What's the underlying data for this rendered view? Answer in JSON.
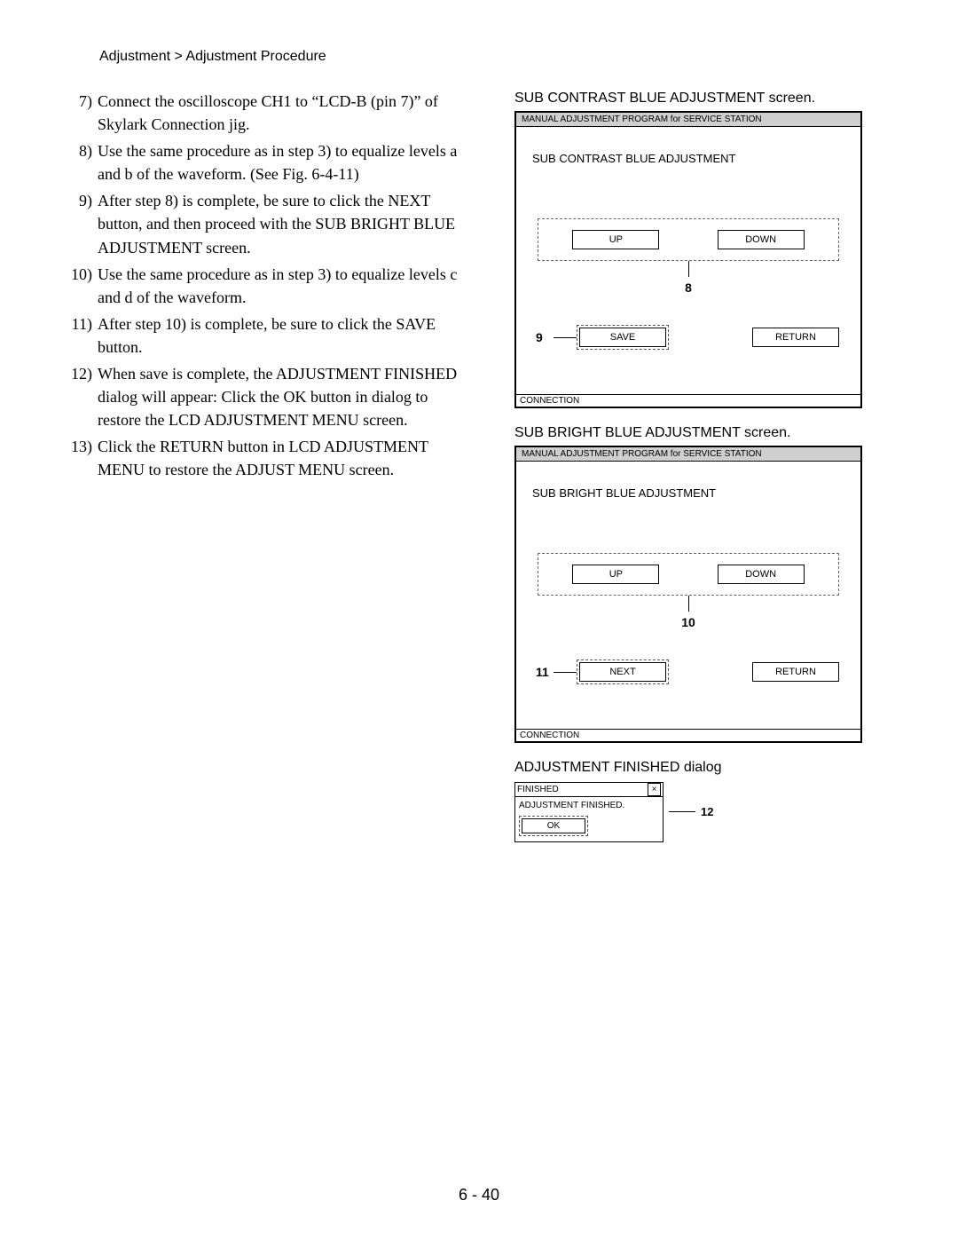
{
  "breadcrumb": "Adjustment > Adjustment Procedure",
  "steps": [
    {
      "num": "7)",
      "text": "Connect the oscilloscope CH1 to “LCD-B (pin 7)” of Skylark Connection jig."
    },
    {
      "num": "8)",
      "text": "Use the same procedure as in step 3) to equalize levels a and b of the waveform. (See Fig. 6-4-11)"
    },
    {
      "num": "9)",
      "text": "After step 8) is complete, be sure to click the NEXT button, and then proceed with the SUB BRIGHT BLUE ADJUSTMENT screen."
    },
    {
      "num": "10)",
      "text": "Use the same procedure as in step 3) to equalize levels c and d of the waveform."
    },
    {
      "num": "11)",
      "text": "After step 10) is complete, be sure to click the SAVE button."
    },
    {
      "num": "12)",
      "text": "When save is complete, the ADJUSTMENT FINISHED dialog will appear: Click the OK button in dialog to restore the LCD ADJUSTMENT MENU screen."
    },
    {
      "num": "13)",
      "text": "Click the RETURN button in LCD ADJUSTMENT MENU to restore the ADJUST MENU screen."
    }
  ],
  "fig1": {
    "caption": "SUB CONTRAST BLUE ADJUSTMENT screen.",
    "titlebar": "MANUAL ADJUSTMENT PROGRAM for SERVICE STATION",
    "heading": "SUB CONTRAST BLUE ADJUSTMENT",
    "up": "UP",
    "down": "DOWN",
    "updown_callout": "8",
    "action_left": "SAVE",
    "action_right": "RETURN",
    "action_callout": "9",
    "status": "CONNECTION"
  },
  "fig2": {
    "caption": "SUB BRIGHT BLUE ADJUSTMENT screen.",
    "titlebar": "MANUAL ADJUSTMENT PROGRAM for SERVICE STATION",
    "heading": "SUB BRIGHT BLUE ADJUSTMENT",
    "up": "UP",
    "down": "DOWN",
    "updown_callout": "10",
    "action_left": "NEXT",
    "action_right": "RETURN",
    "action_callout": "11",
    "status": "CONNECTION"
  },
  "dialog": {
    "caption": "ADJUSTMENT FINISHED dialog",
    "title": "FINISHED",
    "message": "ADJUSTMENT FINISHED.",
    "ok": "OK",
    "callout": "12"
  },
  "page_number": "6 - 40"
}
